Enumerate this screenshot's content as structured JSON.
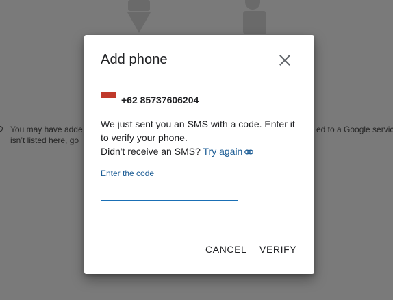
{
  "background": {
    "text_line_1_left": "You may have adde",
    "text_line_2_left": "isn’t listed here, go",
    "text_line_1_right": "ed to a Google servic"
  },
  "dialog": {
    "title": "Add phone",
    "close_icon": "close-icon",
    "phone": {
      "flag": "indonesia-flag-icon",
      "number": "+62 85737606204"
    },
    "message_line": "We just sent you an SMS with a code. Enter it to verify your phone.",
    "prompt": "Didn't receive an SMS?",
    "retry_label": "Try again",
    "retry_icon": "link-icon",
    "code_field": {
      "label": "Enter the code",
      "value": "",
      "placeholder": ""
    },
    "cancel_label": "CANCEL",
    "verify_label": "VERIFY"
  },
  "colors": {
    "accent": "#1a5b94",
    "input_underline": "#1a6fb5",
    "overlay": "#7a7a7a",
    "flag_red": "#c0392b"
  }
}
